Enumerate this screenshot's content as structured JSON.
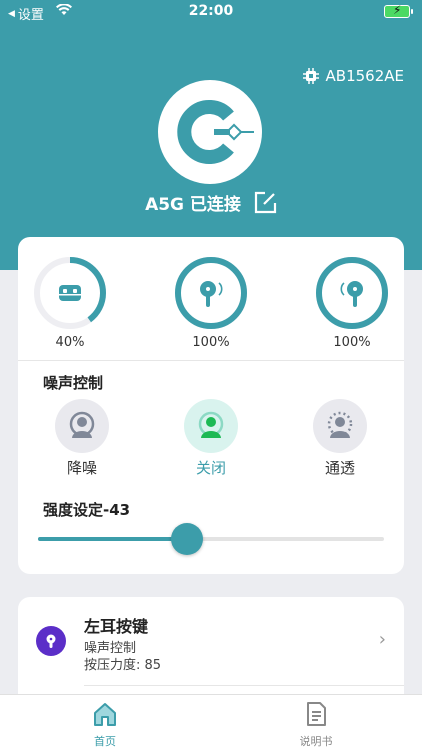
{
  "status_bar": {
    "back_label": "设置",
    "time": "22:00"
  },
  "header": {
    "device_id": "AB1562AE",
    "connection_status": "A5G 已连接"
  },
  "colors": {
    "accent": "#3C9DAA",
    "mode_active": "#1DB954",
    "ear_key_icon_bg": "#5B2EC8"
  },
  "batteries": [
    {
      "name": "case",
      "icon": "case-icon",
      "percent_label": "40%",
      "level": 0.4
    },
    {
      "name": "left-earbud",
      "icon": "earbud-left-icon",
      "percent_label": "100%",
      "level": 1.0
    },
    {
      "name": "right-earbud",
      "icon": "earbud-right-icon",
      "percent_label": "100%",
      "level": 1.0
    }
  ],
  "noise_control": {
    "title": "噪声控制",
    "modes": [
      {
        "label": "降噪",
        "icon": "anc-icon",
        "active": false
      },
      {
        "label": "关闭",
        "icon": "off-icon",
        "active": true
      },
      {
        "label": "通透",
        "icon": "transparency-icon",
        "active": false
      }
    ]
  },
  "intensity": {
    "title": "强度设定-43",
    "level": 0.43
  },
  "ear_key": {
    "title": "左耳按键",
    "line1": "噪声控制",
    "line2": "按压力度: 85"
  },
  "tabs": [
    {
      "label": "首页",
      "icon": "home-icon",
      "active": true
    },
    {
      "label": "说明书",
      "icon": "manual-icon",
      "active": false
    }
  ]
}
